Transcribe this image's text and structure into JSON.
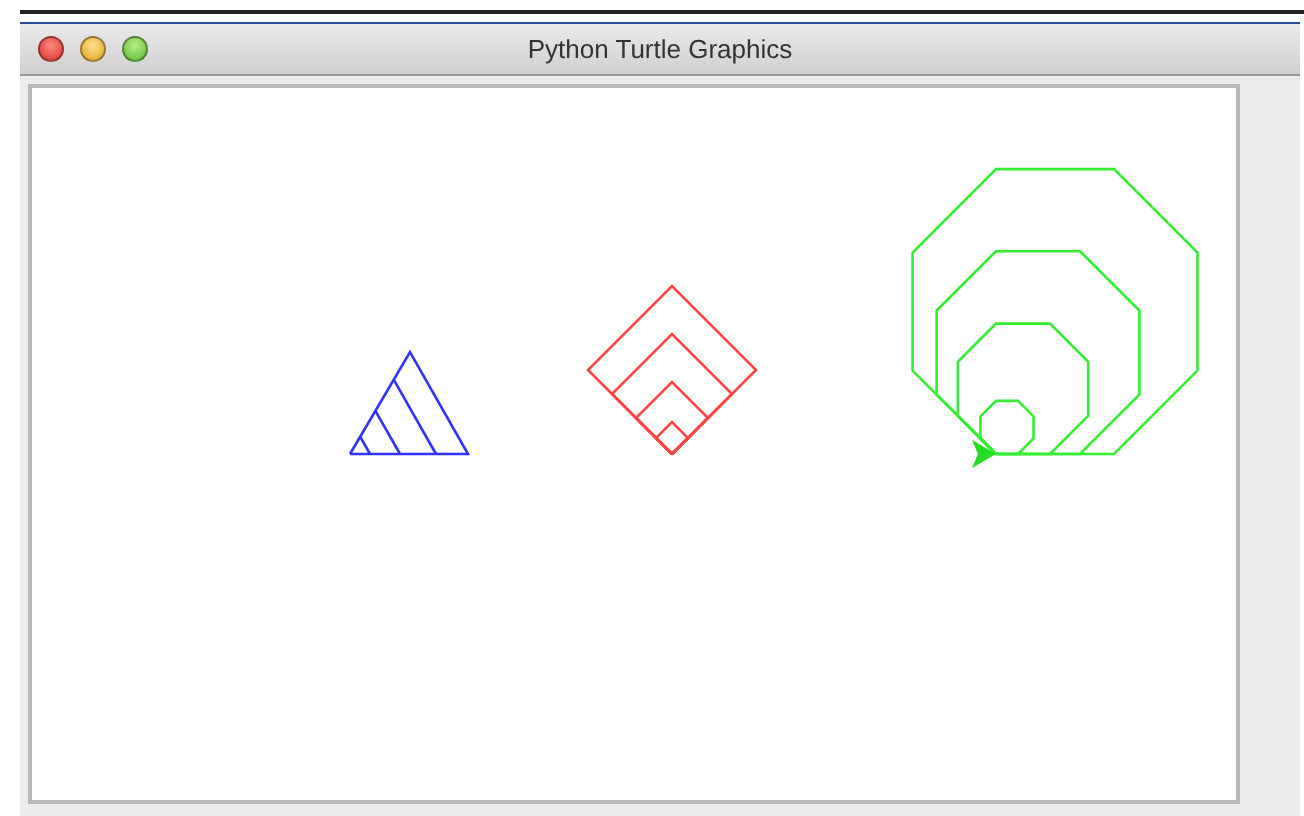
{
  "window": {
    "title": "Python Turtle Graphics"
  },
  "canvas": {
    "shapes": [
      {
        "kind": "triangle",
        "color": "#3333ff"
      },
      {
        "kind": "diamond",
        "color": "#ff4444"
      },
      {
        "kind": "octagons",
        "color": "#33ee33"
      }
    ],
    "turtle": {
      "kind": "arrow",
      "color": "#22dd22"
    }
  }
}
